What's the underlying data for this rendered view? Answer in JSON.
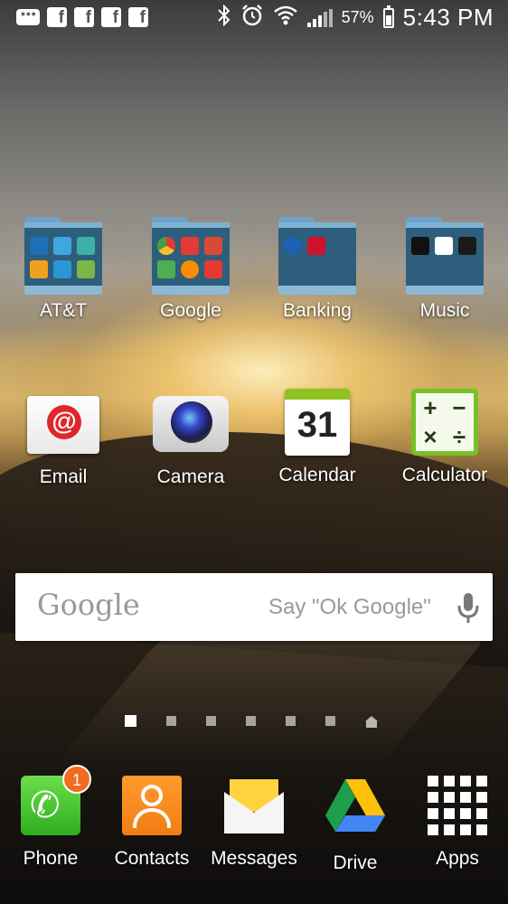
{
  "status_bar": {
    "notification_icons": [
      "messenger-icon",
      "facebook-icon",
      "facebook-icon",
      "facebook-icon",
      "facebook-icon"
    ],
    "system_icons": [
      "bluetooth-icon",
      "alarm-icon",
      "wifi-icon",
      "signal-icon"
    ],
    "battery_percent": "57%",
    "time": "5:43 PM"
  },
  "home": {
    "folders": [
      {
        "label": "AT&T"
      },
      {
        "label": "Google"
      },
      {
        "label": "Banking"
      },
      {
        "label": "Music"
      }
    ],
    "apps": [
      {
        "label": "Email"
      },
      {
        "label": "Camera"
      },
      {
        "label": "Calendar",
        "date": "31"
      },
      {
        "label": "Calculator",
        "keys": [
          "+",
          "−",
          "×",
          "÷"
        ]
      }
    ]
  },
  "search_widget": {
    "logo": "Google",
    "hint": "Say \"Ok Google\""
  },
  "page_indicator": {
    "pages": 7,
    "current": 1
  },
  "dock": [
    {
      "label": "Phone",
      "badge": "1"
    },
    {
      "label": "Contacts"
    },
    {
      "label": "Messages"
    },
    {
      "label": "Drive"
    },
    {
      "label": "Apps"
    }
  ]
}
